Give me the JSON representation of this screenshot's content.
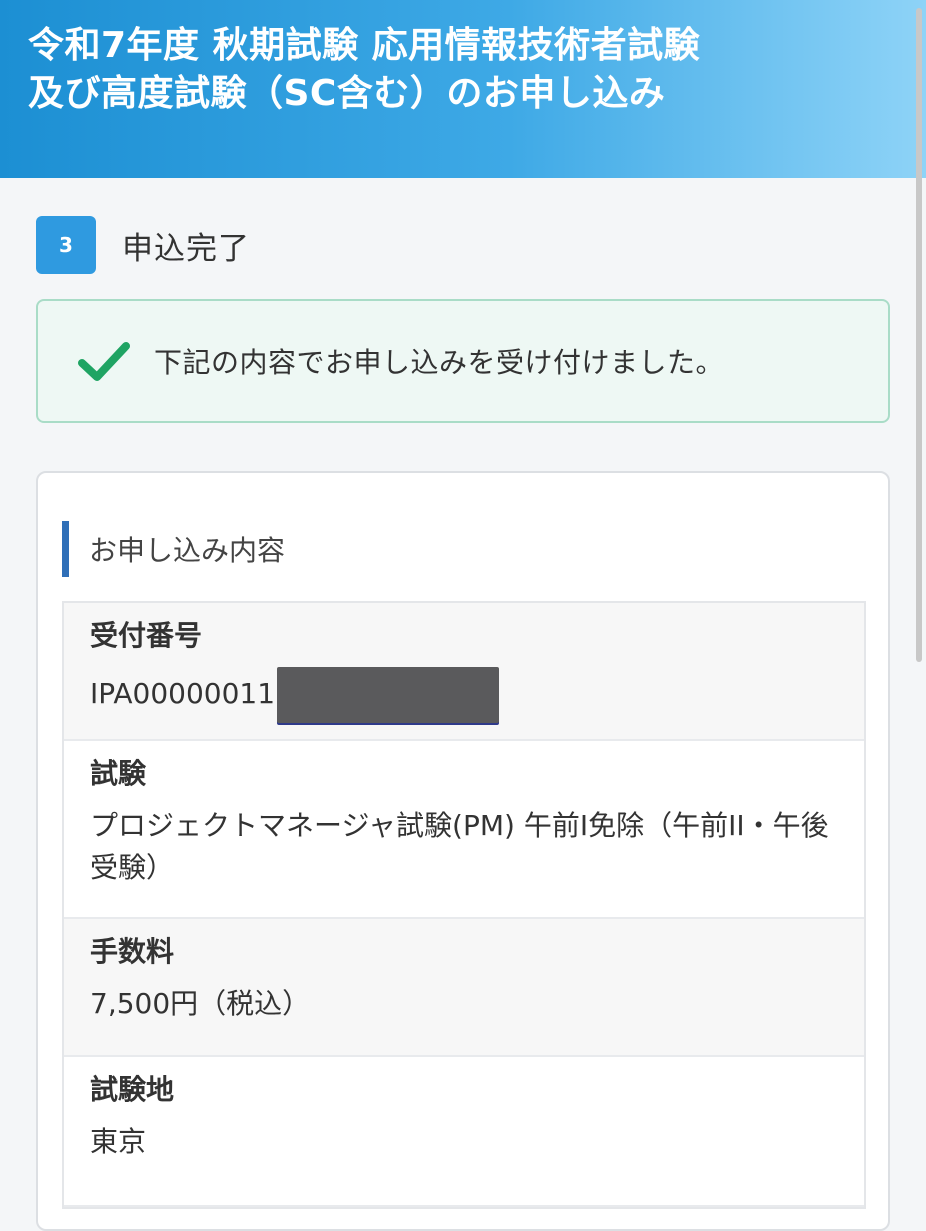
{
  "header": {
    "title": "令和7年度 秋期試験 応用情報技術者試験及び高度試験（SC含む）のお申し込み"
  },
  "step": {
    "number": "3",
    "label": "申込完了"
  },
  "alert": {
    "icon": "checkmark-icon",
    "message": "下記の内容でお申し込みを受け付けました。",
    "colors": {
      "background": "#eef8f4",
      "border": "#a9dcc7",
      "check": "#1fa463"
    }
  },
  "details": {
    "title": "お申し込み内容",
    "rows": [
      {
        "label": "受付番号",
        "value": "IPA00000011"
      },
      {
        "label": "試験",
        "value": "プロジェクトマネージャ試験(PM) 午前I免除（午前II・午後受験）"
      },
      {
        "label": "手数料",
        "value": "7,500円（税込）"
      },
      {
        "label": "試験地",
        "value": "東京"
      }
    ]
  },
  "colors": {
    "header_gradient_start": "#1c8fd3",
    "header_gradient_end": "#8ed3f7",
    "step_badge": "#2f9ae0",
    "section_accent": "#2f6fb8"
  }
}
